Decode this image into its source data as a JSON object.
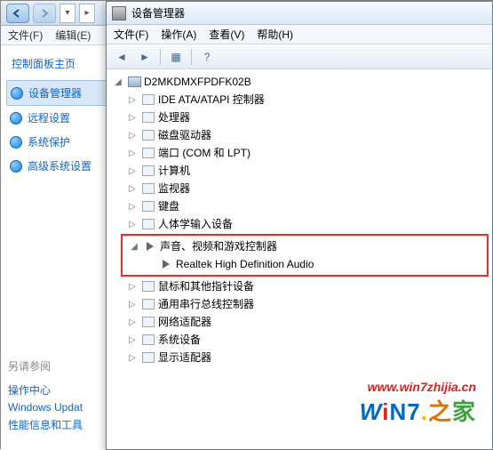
{
  "back": {
    "menubar": {
      "file": "文件(F)",
      "edit": "编辑(E)"
    },
    "cp_home": "控制面板主页",
    "items": [
      {
        "label": "设备管理器",
        "active": true
      },
      {
        "label": "远程设置",
        "active": false
      },
      {
        "label": "系统保护",
        "active": false
      },
      {
        "label": "高级系统设置",
        "active": false
      }
    ],
    "see_also_hdr": "另请参阅",
    "see_also": [
      "操作中心",
      "Windows Updat",
      "性能信息和工具"
    ]
  },
  "dm": {
    "title": "设备管理器",
    "menu": {
      "file": "文件(F)",
      "action": "操作(A)",
      "view": "查看(V)",
      "help": "帮助(H)"
    },
    "root": "D2MKDMXFPDFK02B",
    "nodes": [
      {
        "label": "IDE ATA/ATAPI 控制器"
      },
      {
        "label": "处理器"
      },
      {
        "label": "磁盘驱动器"
      },
      {
        "label": "端口 (COM 和 LPT)"
      },
      {
        "label": "计算机"
      },
      {
        "label": "监视器"
      },
      {
        "label": "键盘"
      },
      {
        "label": "人体学输入设备"
      }
    ],
    "highlighted": {
      "parent": "声音、视频和游戏控制器",
      "child": "Realtek High Definition Audio"
    },
    "nodes_after": [
      {
        "label": "鼠标和其他指针设备"
      },
      {
        "label": "通用串行总线控制器"
      },
      {
        "label": "网络适配器"
      },
      {
        "label": "系统设备"
      },
      {
        "label": "显示适配器"
      }
    ]
  },
  "watermark": {
    "url": "www.win7zhijia.cn"
  }
}
